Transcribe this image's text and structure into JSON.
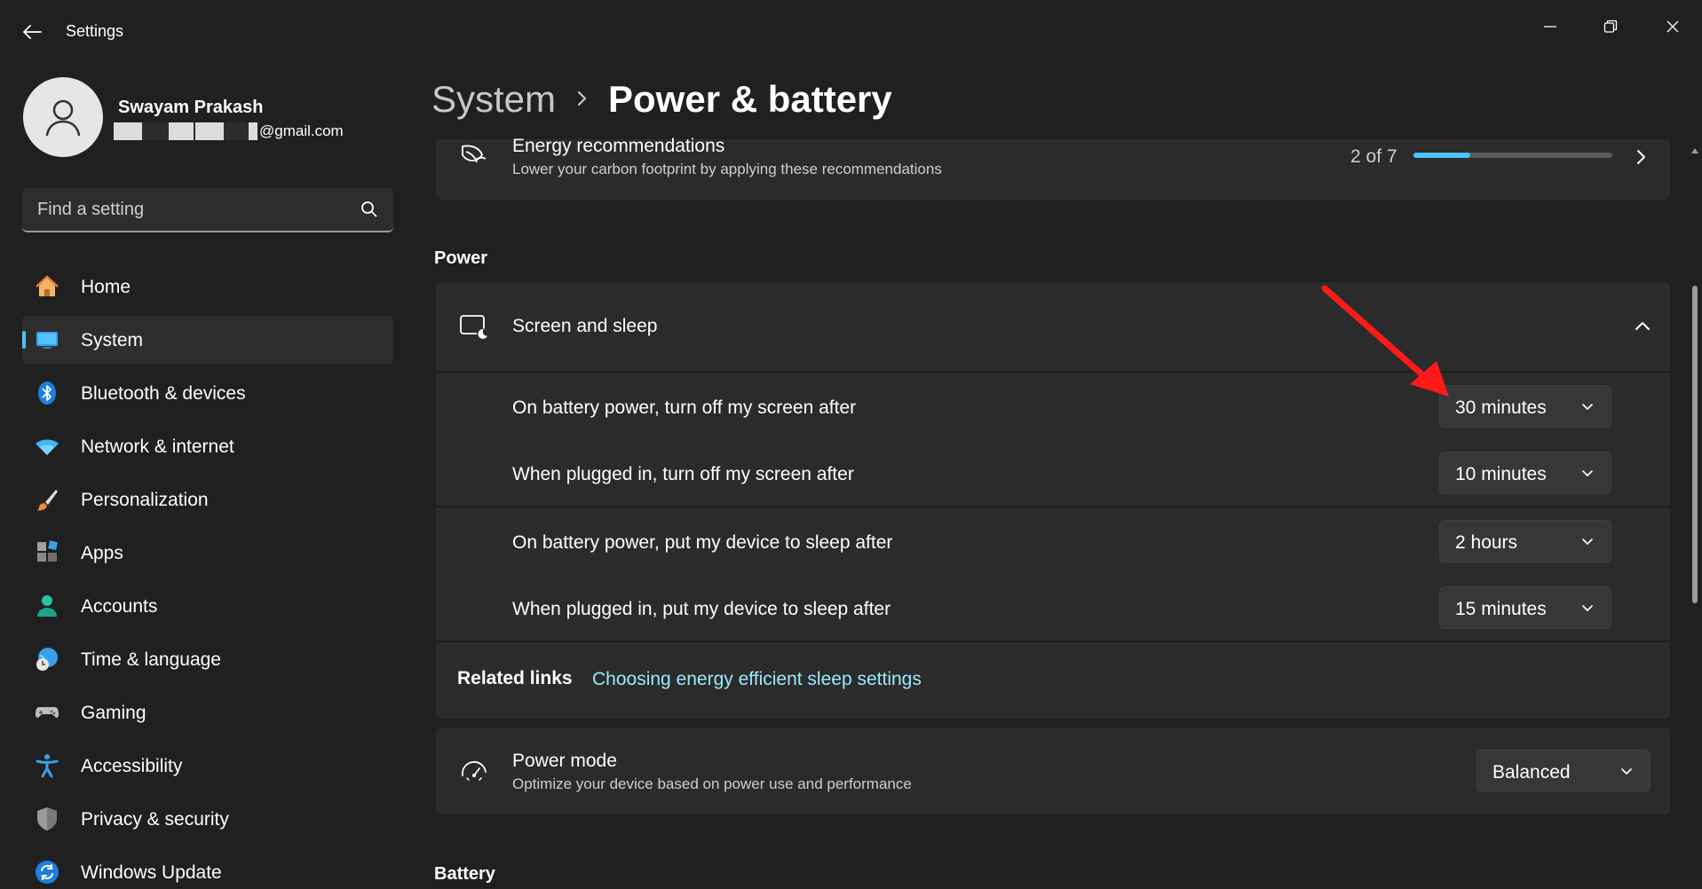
{
  "window": {
    "title": "Settings"
  },
  "user": {
    "name": "Swayam Prakash",
    "email_suffix": "@gmail.com"
  },
  "search": {
    "placeholder": "Find a setting"
  },
  "sidebar": {
    "items": [
      {
        "label": "Home",
        "icon": "home-icon"
      },
      {
        "label": "System",
        "icon": "system-icon",
        "selected": true
      },
      {
        "label": "Bluetooth & devices",
        "icon": "bluetooth-icon"
      },
      {
        "label": "Network & internet",
        "icon": "wifi-icon"
      },
      {
        "label": "Personalization",
        "icon": "brush-icon"
      },
      {
        "label": "Apps",
        "icon": "apps-icon"
      },
      {
        "label": "Accounts",
        "icon": "accounts-icon"
      },
      {
        "label": "Time & language",
        "icon": "time-language-icon"
      },
      {
        "label": "Gaming",
        "icon": "gaming-icon"
      },
      {
        "label": "Accessibility",
        "icon": "accessibility-icon"
      },
      {
        "label": "Privacy & security",
        "icon": "shield-icon"
      },
      {
        "label": "Windows Update",
        "icon": "update-icon"
      }
    ]
  },
  "header": {
    "breadcrumb_parent": "System",
    "page_title": "Power & battery"
  },
  "energy": {
    "title": "Energy recommendations",
    "subtitle": "Lower your carbon footprint by applying these recommendations",
    "progress_text": "2 of 7",
    "progress_fraction": 0.2857
  },
  "power": {
    "section_title": "Power",
    "screen_sleep": {
      "title": "Screen and sleep",
      "rows": [
        {
          "label": "On battery power, turn off my screen after",
          "value": "30 minutes"
        },
        {
          "label": "When plugged in, turn off my screen after",
          "value": "10 minutes"
        },
        {
          "label": "On battery power, put my device to sleep after",
          "value": "2 hours"
        },
        {
          "label": "When plugged in, put my device to sleep after",
          "value": "15 minutes"
        }
      ],
      "related_links_label": "Related links",
      "related_link": "Choosing energy efficient sleep settings"
    },
    "power_mode": {
      "title": "Power mode",
      "subtitle": "Optimize your device based on power use and performance",
      "value": "Balanced"
    }
  },
  "battery": {
    "section_title": "Battery"
  },
  "colors": {
    "accent": "#4cc2ff",
    "annotation_arrow": "#ff1a1a",
    "background": "#202020",
    "card": "#2b2b2b"
  }
}
